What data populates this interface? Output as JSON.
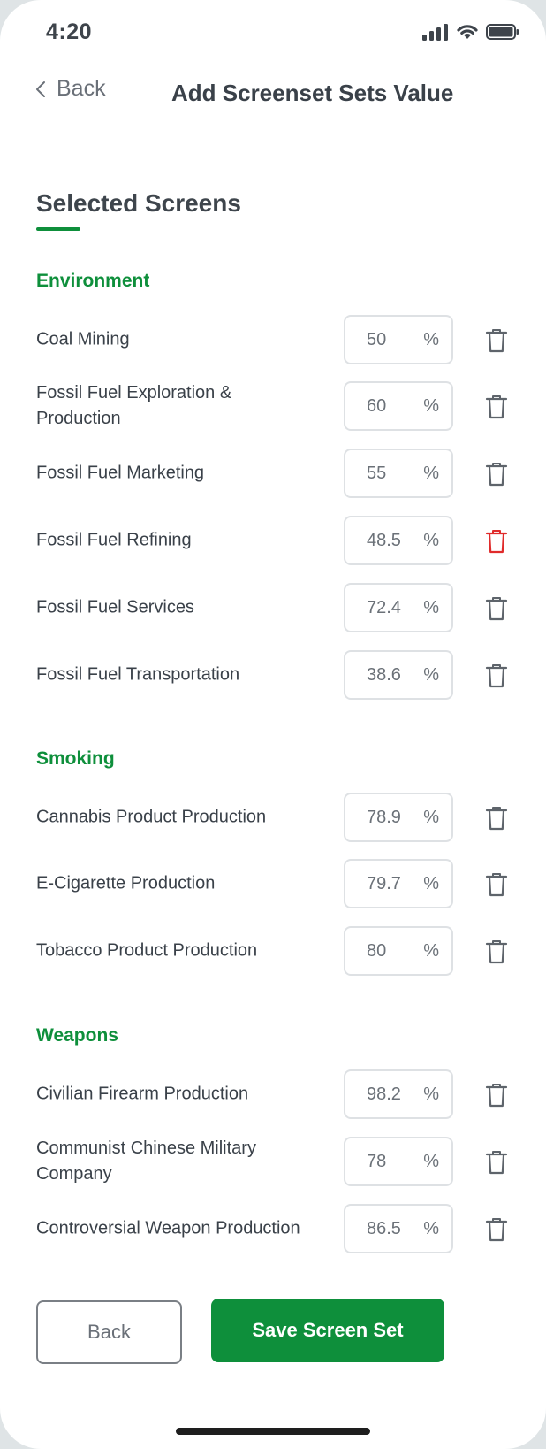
{
  "status_bar": {
    "time": "4:20"
  },
  "nav": {
    "back_label": "Back",
    "title": "Add Screenset Sets Value"
  },
  "section": {
    "title": "Selected Screens"
  },
  "colors": {
    "accent": "#0e8f3b",
    "danger": "#e02b2b",
    "icon": "#5e646b"
  },
  "groups": [
    {
      "title": "Environment",
      "items": [
        {
          "label": "Coal Mining",
          "value": "50",
          "unit": "%",
          "delete_icon": "trash-icon"
        },
        {
          "label": "Fossil Fuel Exploration & Production",
          "value": "60",
          "unit": "%",
          "delete_icon": "trash-icon"
        },
        {
          "label": "Fossil Fuel Marketing",
          "value": "55",
          "unit": "%",
          "delete_icon": "trash-icon"
        },
        {
          "label": "Fossil Fuel Refining",
          "value": "48.5",
          "unit": "%",
          "delete_icon": "trash-icon",
          "delete_highlight": true
        },
        {
          "label": "Fossil Fuel Services",
          "value": "72.4",
          "unit": "%",
          "delete_icon": "trash-icon"
        },
        {
          "label": "Fossil Fuel Transportation",
          "value": "38.6",
          "unit": "%",
          "delete_icon": "trash-icon"
        }
      ]
    },
    {
      "title": "Smoking",
      "items": [
        {
          "label": "Cannabis Product Production",
          "value": "78.9",
          "unit": "%",
          "delete_icon": "trash-icon"
        },
        {
          "label": "E-Cigarette Production",
          "value": "79.7",
          "unit": "%",
          "delete_icon": "trash-icon"
        },
        {
          "label": "Tobacco Product Production",
          "value": "80",
          "unit": "%",
          "delete_icon": "trash-icon"
        }
      ]
    },
    {
      "title": "Weapons",
      "items": [
        {
          "label": "Civilian Firearm Production",
          "value": "98.2",
          "unit": "%",
          "delete_icon": "trash-icon"
        },
        {
          "label": "Communist Chinese Military Company",
          "value": "78",
          "unit": "%",
          "delete_icon": "trash-icon"
        },
        {
          "label": "Controversial Weapon Production",
          "value": "86.5",
          "unit": "%",
          "delete_icon": "trash-icon"
        }
      ]
    }
  ],
  "footer": {
    "back_label": "Back",
    "save_label": "Save Screen Set"
  }
}
